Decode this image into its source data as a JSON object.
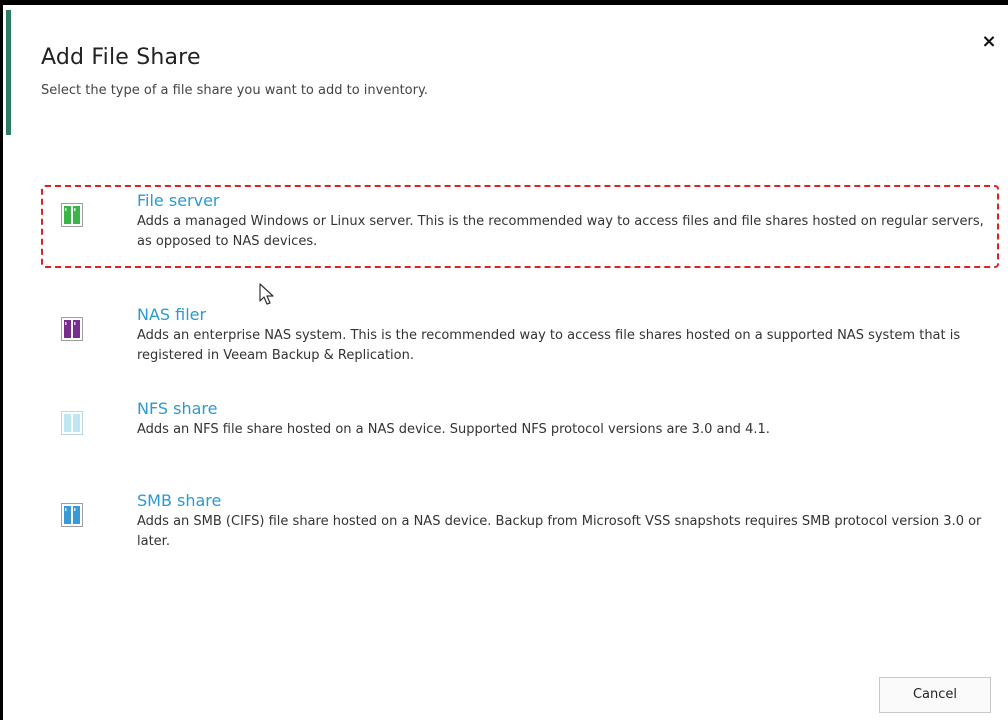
{
  "dialog": {
    "title": "Add File Share",
    "subtitle": "Select the type of a file share you want to add to inventory.",
    "close_label": "×"
  },
  "options": [
    {
      "title": "File server",
      "description": "Adds a managed Windows or Linux server. This is the recommended way to access files and file shares hosted on regular servers, as opposed to NAS devices.",
      "icon": "file-server-icon",
      "icon_color": "#3bb54a"
    },
    {
      "title": "NAS filer",
      "description": "Adds an enterprise NAS system. This is the recommended way to access file shares hosted on a supported NAS system that is registered in Veeam Backup & Replication.",
      "icon": "nas-filer-icon",
      "icon_color": "#7b2d8e"
    },
    {
      "title": "NFS share",
      "description": "Adds an NFS file share hosted on a NAS device. Supported NFS protocol versions are 3.0 and 4.1.",
      "icon": "nfs-share-icon",
      "icon_color": "#a8dcee"
    },
    {
      "title": "SMB share",
      "description": "Adds an SMB (CIFS) file share hosted on a NAS device. Backup from Microsoft VSS snapshots requires SMB protocol version 3.0 or later.",
      "icon": "smb-share-icon",
      "icon_color": "#3a9ad6"
    }
  ],
  "footer": {
    "cancel_label": "Cancel"
  },
  "colors": {
    "link_blue": "#2a9ad2",
    "highlight_red": "#dd2222",
    "accent_green": "#2e7d62"
  }
}
